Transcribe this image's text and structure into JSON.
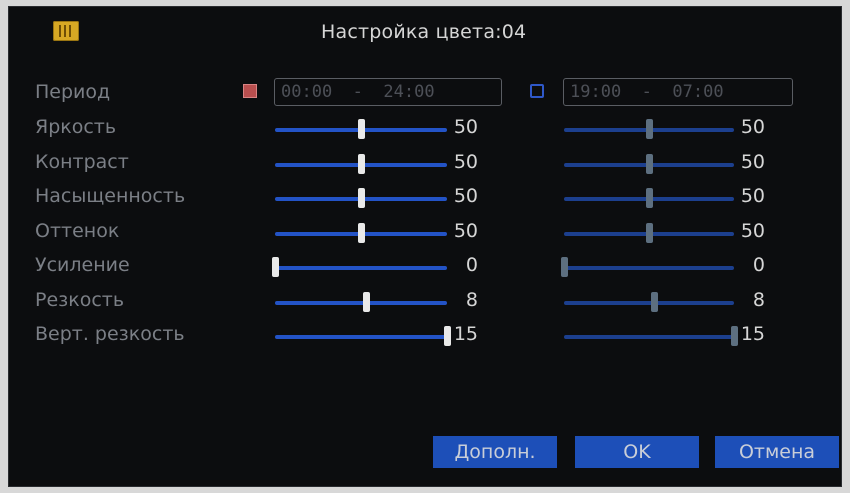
{
  "title": "Настройка цвета:04",
  "period": {
    "label": "Период",
    "range1": {
      "enabled": true,
      "start": "00:00",
      "end": "24:00"
    },
    "range2": {
      "enabled": false,
      "start": "19:00",
      "end": "07:00"
    }
  },
  "rows": [
    {
      "key": "brightness",
      "label": "Яркость",
      "v1": "50",
      "v2": "50",
      "p1": 0.5,
      "p2": 0.5
    },
    {
      "key": "contrast",
      "label": "Контраст",
      "v1": "50",
      "v2": "50",
      "p1": 0.5,
      "p2": 0.5
    },
    {
      "key": "saturation",
      "label": "Насыщенность",
      "v1": "50",
      "v2": "50",
      "p1": 0.5,
      "p2": 0.5
    },
    {
      "key": "hue",
      "label": "Оттенок",
      "v1": "50",
      "v2": "50",
      "p1": 0.5,
      "p2": 0.5
    },
    {
      "key": "gain",
      "label": "Усиление",
      "v1": "0",
      "v2": "0",
      "p1": 0.0,
      "p2": 0.0
    },
    {
      "key": "sharpness",
      "label": "Резкость",
      "v1": "8",
      "v2": "8",
      "p1": 0.53,
      "p2": 0.53
    },
    {
      "key": "vert-sharpness",
      "label": "Верт. резкость",
      "v1": "15",
      "v2": "15",
      "p1": 1.0,
      "p2": 1.0
    }
  ],
  "buttons": {
    "advanced": "Дополн.",
    "ok": "OK",
    "cancel": "Отмена"
  },
  "colors": {
    "accent": "#2353c6",
    "button": "#1d4fb8",
    "background": "#0c0d0f",
    "checked": "#b94f4f"
  }
}
